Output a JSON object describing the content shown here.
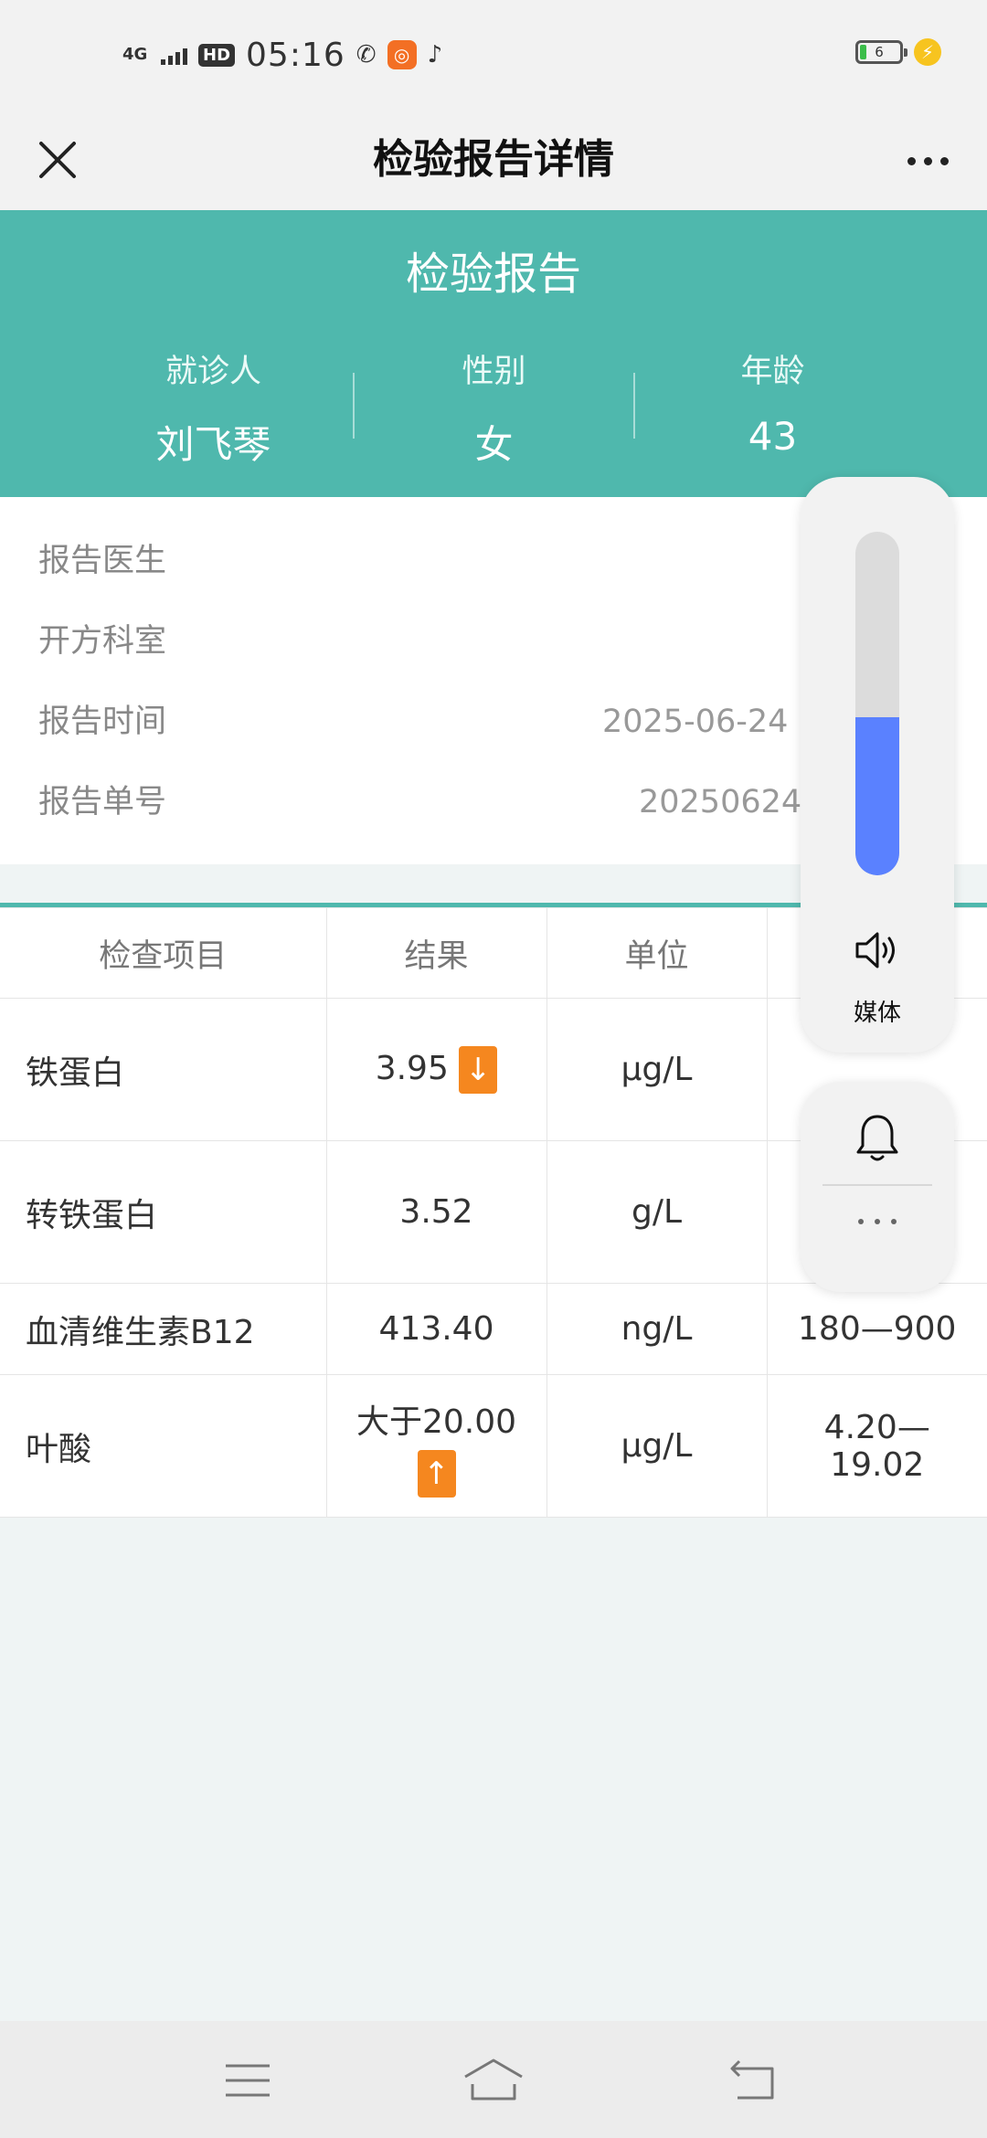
{
  "status_bar": {
    "network": "4G",
    "hd": "HD",
    "time": "05:16",
    "battery_level": "6",
    "battery_fraction": 0.06,
    "icons": [
      "signal-icon",
      "call-icon",
      "app-icon",
      "tiktok-icon",
      "battery-icon",
      "charging-icon"
    ]
  },
  "nav": {
    "title": "检验报告详情"
  },
  "header": {
    "title": "检验报告",
    "patient_label": "就诊人",
    "patient_value": "刘飞琴",
    "gender_label": "性别",
    "gender_value": "女",
    "age_label": "年龄",
    "age_value": "43"
  },
  "info": {
    "doctor_label": "报告医生",
    "doctor_value": "",
    "dept_label": "开方科室",
    "dept_value": "",
    "time_label": "报告时间",
    "time_value": "2025-06-24",
    "number_label": "报告单号",
    "number_value": "20250624"
  },
  "table": {
    "headers": [
      "检查项目",
      "结果",
      "单位",
      ""
    ],
    "rows": [
      {
        "name": "铁蛋白",
        "result": "3.95",
        "flag": "↓",
        "unit": "µg/L",
        "range": ""
      },
      {
        "name": "转铁蛋白",
        "result": "3.52",
        "flag": "",
        "unit": "g/L",
        "range": ""
      },
      {
        "name": "血清维生素B12",
        "result": "413.40",
        "flag": "",
        "unit": "ng/L",
        "range": "180—900"
      },
      {
        "name": "叶酸",
        "result": "大于20.00",
        "flag": "↑",
        "unit": "µg/L",
        "range": "4.20—19.02"
      }
    ]
  },
  "volume_panel": {
    "level": 0.46,
    "label": "媒体",
    "accent": "#5a81ff"
  },
  "colors": {
    "brand": "#4fb8ad",
    "flag": "#f5871f"
  }
}
